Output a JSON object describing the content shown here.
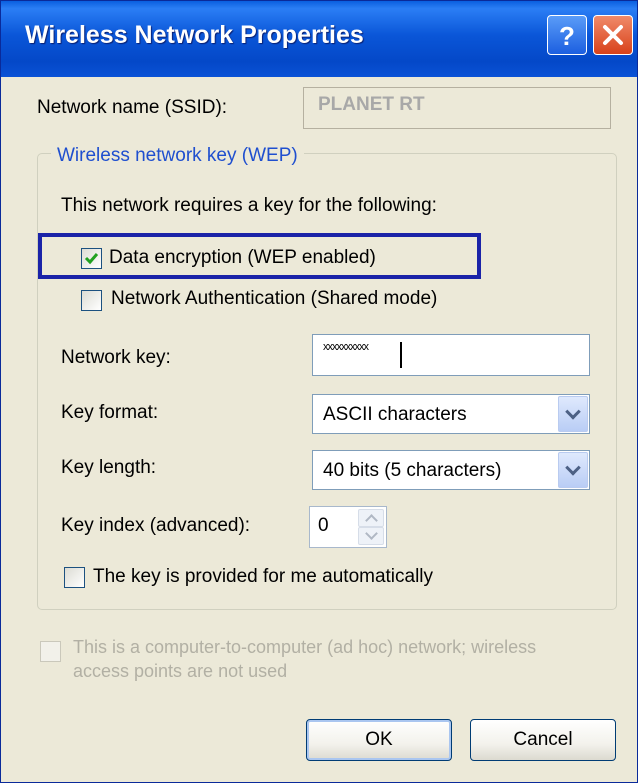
{
  "window": {
    "title": "Wireless Network Properties",
    "help_icon": "?",
    "close_icon": "close-x"
  },
  "ssid": {
    "label": "Network name (SSID):",
    "value": "PLANET RT"
  },
  "wep_group": {
    "legend": "Wireless network key (WEP)",
    "requires_text": "This network requires a key for the following:",
    "data_encryption": {
      "label": "Data encryption (WEP enabled)",
      "checked": true
    },
    "network_auth": {
      "label": "Network Authentication (Shared mode)",
      "checked": false
    },
    "network_key": {
      "label": "Network key:",
      "value": "xxxxxxxxxx"
    },
    "key_format": {
      "label": "Key format:",
      "selected": "ASCII characters"
    },
    "key_length": {
      "label": "Key length:",
      "selected": "40 bits (5 characters)"
    },
    "key_index": {
      "label": "Key index (advanced):",
      "value": "0"
    },
    "auto_key": {
      "label": "The key is provided for me automatically",
      "checked": false
    }
  },
  "adhoc": {
    "label_line1": "This is a computer-to-computer (ad hoc) network; wireless",
    "label_line2": "access points are not used",
    "checked": false,
    "enabled": false
  },
  "buttons": {
    "ok": "OK",
    "cancel": "Cancel"
  },
  "colors": {
    "title_bar": "#0a56d8",
    "highlight_box": "#1a23a8",
    "group_legend": "#1f4fcf",
    "dialog_bg": "#ece9d8"
  }
}
